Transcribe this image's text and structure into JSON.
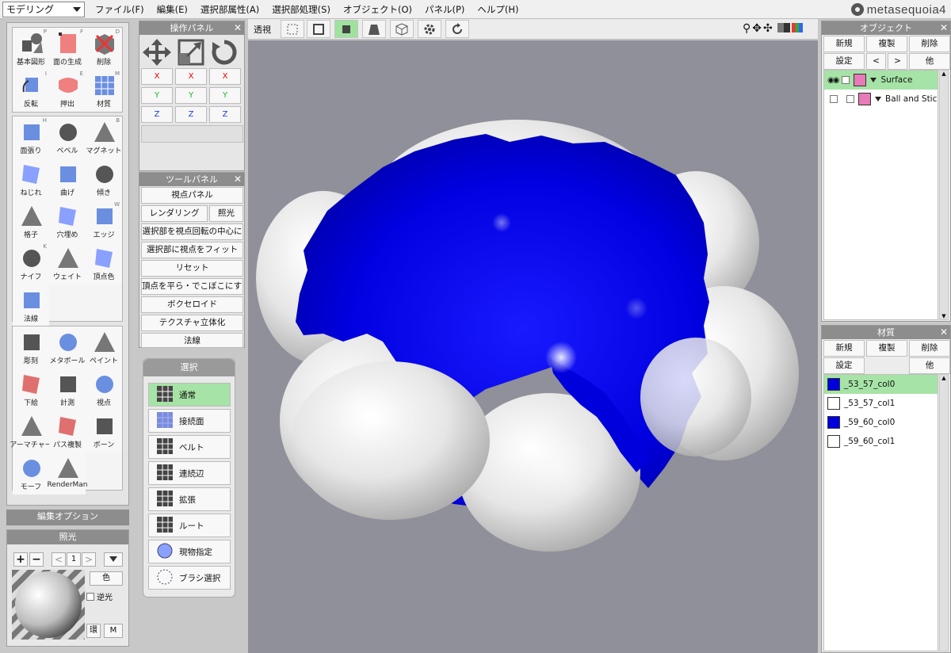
{
  "app": {
    "mode": "モデリング",
    "logo_text": "metasequoia4"
  },
  "menu": [
    "ファイル(F)",
    "編集(E)",
    "選択部属性(A)",
    "選択部処理(S)",
    "オブジェクト(O)",
    "パネル(P)",
    "ヘルプ(H)"
  ],
  "commands": {
    "group1": [
      {
        "label": "基本図形",
        "key": "P"
      },
      {
        "label": "面の生成",
        "key": "F"
      },
      {
        "label": "削除",
        "key": "D"
      },
      {
        "label": "反転",
        "key": "I"
      },
      {
        "label": "押出",
        "key": "E"
      },
      {
        "label": "材質",
        "key": "M"
      }
    ],
    "group2": [
      {
        "label": "面張り",
        "key": "H"
      },
      {
        "label": "ベベル",
        "key": ""
      },
      {
        "label": "マグネット",
        "key": "B"
      },
      {
        "label": "ねじれ",
        "key": ""
      },
      {
        "label": "曲げ",
        "key": ""
      },
      {
        "label": "傾き",
        "key": ""
      },
      {
        "label": "格子",
        "key": ""
      },
      {
        "label": "穴埋め",
        "key": ""
      },
      {
        "label": "エッジ",
        "key": "W"
      },
      {
        "label": "ナイフ",
        "key": "K"
      },
      {
        "label": "ウェイト",
        "key": ""
      },
      {
        "label": "頂点色",
        "key": ""
      },
      {
        "label": "法線",
        "key": ""
      }
    ],
    "group3": [
      {
        "label": "彫刻",
        "key": ""
      },
      {
        "label": "メタボール",
        "key": ""
      },
      {
        "label": "ペイント",
        "key": ""
      },
      {
        "label": "下絵",
        "key": ""
      },
      {
        "label": "計測",
        "key": ""
      },
      {
        "label": "視点",
        "key": ""
      },
      {
        "label": "アーマチャー",
        "key": ""
      },
      {
        "label": "パス複製",
        "key": ""
      },
      {
        "label": "ボーン",
        "key": ""
      },
      {
        "label": "モーフ",
        "key": ""
      },
      {
        "label": "RenderMan",
        "key": ""
      }
    ]
  },
  "edit_options": {
    "title": "編集オプション"
  },
  "lighting": {
    "title": "照光",
    "index": "1",
    "color_label": "色",
    "backlight_label": "逆光",
    "btn1": "環",
    "btn2": "M"
  },
  "operation_panel": {
    "title": "操作パネル",
    "axes": [
      "X",
      "Y",
      "Z"
    ]
  },
  "tool_panel": {
    "title": "ツールパネル",
    "buttons": [
      "視点パネル",
      "レンダリング",
      "照光",
      "選択部を視点回転の中心に",
      "選択部に視点をフィット",
      "リセット",
      "頂点を平ら・でこぼこにする",
      "ボクセロイド",
      "テクスチャ立体化",
      "法線"
    ]
  },
  "select_panel": {
    "title": "選択",
    "items": [
      "通常",
      "接続面",
      "ベルト",
      "連続辺",
      "拡張",
      "ルート",
      "現物指定",
      "ブラシ選択"
    ]
  },
  "viewport": {
    "mode_label": "透視"
  },
  "object_panel": {
    "title": "オブジェクト",
    "new": "新規",
    "dup": "複製",
    "del": "削除",
    "settings": "設定",
    "prev": "<",
    "next": ">",
    "other": "他",
    "objects": [
      {
        "name": "Surface",
        "color": "#e87ab8"
      },
      {
        "name": "Ball and Stick",
        "color": "#e87ab8"
      }
    ]
  },
  "material_panel": {
    "title": "材質",
    "new": "新規",
    "dup": "複製",
    "del": "削除",
    "settings": "設定",
    "other": "他",
    "materials": [
      {
        "name": "_53_57_col0",
        "color": "#0000dd"
      },
      {
        "name": "_53_57_col1",
        "color": "#ffffff"
      },
      {
        "name": "_59_60_col0",
        "color": "#0000dd"
      },
      {
        "name": "_59_60_col1",
        "color": "#ffffff"
      }
    ]
  },
  "colors": {
    "accent_green": "#a6e3a6",
    "mesh_blue": "#0000e6",
    "mesh_white": "#f0f0f0",
    "viewport_bg": "#8f9099"
  }
}
